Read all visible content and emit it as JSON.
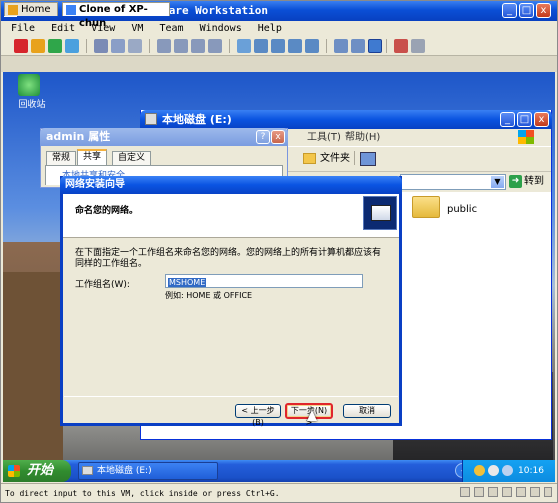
{
  "vmware": {
    "title": "Clone of XP-chun - VMware Workstation",
    "menu": [
      "File",
      "Edit",
      "View",
      "VM",
      "Team",
      "Windows",
      "Help"
    ],
    "window_buttons": [
      "_",
      "□",
      "x"
    ],
    "tabs": [
      {
        "label": "Home",
        "icon": "home-icon"
      },
      {
        "label": "Clone of XP-chun",
        "icon": "vm-icon"
      }
    ],
    "status_text": "To direct input to this VM, click inside or press Ctrl+G."
  },
  "desktop": {
    "recycle_bin_label": "回收站"
  },
  "explorer": {
    "title": "本地磁盘 (E:)",
    "menu": [
      "工具(T)",
      "帮助(H)"
    ],
    "toolbar_folders": "文件夹",
    "go_label": "转到",
    "folder_name": "public"
  },
  "properties": {
    "title": "admin 属性",
    "tabs": [
      "常规",
      "共享",
      "自定义"
    ],
    "active_tab": "共享",
    "section_text": "本地共享和安全",
    "buttons": [
      "?",
      "x"
    ]
  },
  "wizard": {
    "title": "网络安装向导",
    "heading": "命名您的网络。",
    "description": "在下面指定一个工作组名来命名您的网络。您的网络上的所有计算机都应该有同样的工作组名。",
    "workgroup_label": "工作组名(W):",
    "workgroup_value": "MSHOME",
    "example": "例如: HOME 或 OFFICE",
    "buttons": {
      "back": "< 上一步(B)",
      "next": "下一步(N) >",
      "cancel": "取消"
    }
  },
  "taskbar": {
    "start_label": "开始",
    "task_label": "本地磁盘 (E:)",
    "clock": "10:16"
  },
  "colors": {
    "titlebar_blue": "#0a53e0",
    "start_green": "#318c2f",
    "highlight_red": "#e0262c"
  }
}
